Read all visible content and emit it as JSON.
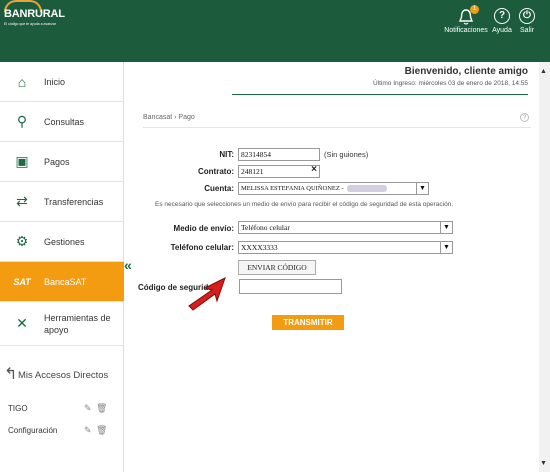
{
  "header": {
    "brand": "BANRURAL",
    "tagline": "El código que te ayuda a avanzar",
    "notifications_label": "Notificaciones",
    "notifications_count": "1",
    "help_label": "Ayuda",
    "exit_label": "Salir",
    "color": "#1c5c3c"
  },
  "sidebar": {
    "items": [
      {
        "label": "Inicio",
        "icon": "home-icon"
      },
      {
        "label": "Consultas",
        "icon": "search-icon"
      },
      {
        "label": "Pagos",
        "icon": "money-icon"
      },
      {
        "label": "Transferencias",
        "icon": "transfer-icon"
      },
      {
        "label": "Gestiones",
        "icon": "management-icon"
      },
      {
        "label": "BancaSAT",
        "icon": "sat-icon",
        "active": true,
        "badge": "SAT"
      },
      {
        "label": "Herramientas de apoyo",
        "icon": "tools-icon"
      }
    ],
    "accesos_label": "Mis Accesos Directos",
    "favorites": [
      "TIGO",
      "Configuración"
    ],
    "active_color": "#f39c12"
  },
  "main": {
    "welcome": "Bienvenido, cliente amigo",
    "last_login": "Último Ingreso: miércoles 03 de enero de 2018, 14:55",
    "breadcrumb": "Bancasat › Pago",
    "help": "?"
  },
  "form": {
    "nit_label": "NIT:",
    "nit_value": "82314854",
    "nit_hint": "(Sin guiones)",
    "contrato_label": "Contrato:",
    "contrato_value": "248121",
    "contrato_clear": "×",
    "cuenta_label": "Cuenta:",
    "cuenta_value": "MELISSA ESTEFANIA QUIÑONEZ -",
    "note": "Es necesario que selecciones un medio de envío para recibir el código de seguridad de esta operación.",
    "medio_label": "Medio de envío:",
    "medio_value": "Teléfono celular",
    "telefono_label": "Teléfono celular:",
    "telefono_value": "XXXX3333",
    "enviar_label": "ENVIAR CÓDIGO",
    "codigo_label": "Código de seguridad:",
    "codigo_value": "",
    "transmitir_label": "TRANSMITIR"
  }
}
